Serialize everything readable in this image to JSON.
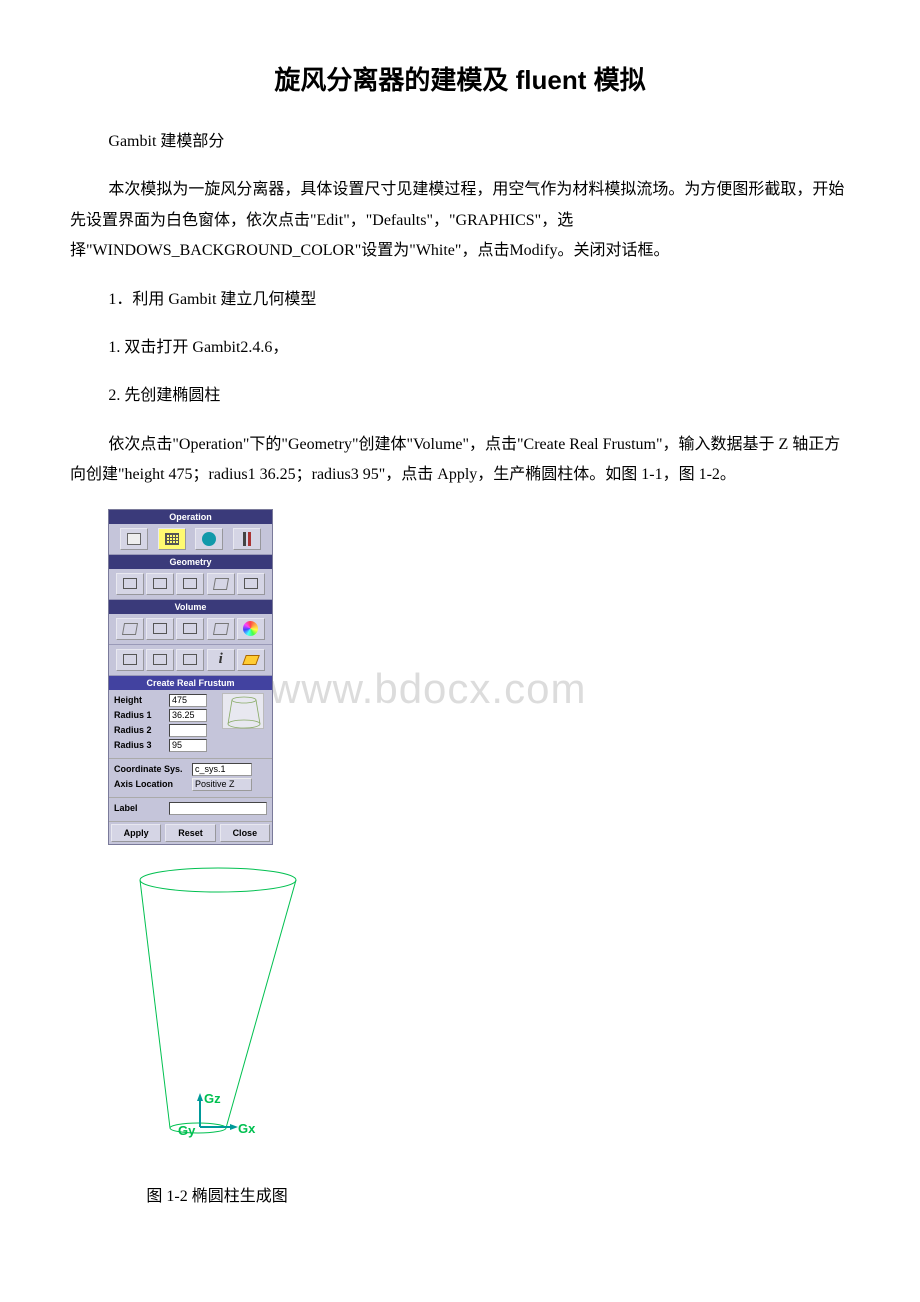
{
  "title": "旋风分离器的建模及 fluent 模拟",
  "paragraphs": {
    "p1": "Gambit 建模部分",
    "p2": "本次模拟为一旋风分离器，具体设置尺寸见建模过程，用空气作为材料模拟流场。为方便图形截取，开始先设置界面为白色窗体，依次点击\"Edit\"，\"Defaults\"，\"GRAPHICS\"，选择\"WINDOWS_BACKGROUND_COLOR\"设置为\"White\"，点击Modify。关闭对话框。",
    "p3": "1．利用 Gambit 建立几何模型",
    "p4": "1. 双击打开 Gambit2.4.6，",
    "p5": "2. 先创建椭圆柱",
    "p6": "依次点击\"Operation\"下的\"Geometry\"创建体\"Volume\"，点击\"Create Real Frustum\"，输入数据基于 Z 轴正方向创建\"height 475；radius1 36.25；radius3 95\"，点击 Apply，生产椭圆柱体。如图 1-1，图 1-2。"
  },
  "watermark": "www.bdocx.com",
  "panel": {
    "operation": "Operation",
    "geometry": "Geometry",
    "volume": "Volume",
    "create_frustum": "Create Real Frustum",
    "height_label": "Height",
    "height_value": "475",
    "radius1_label": "Radius 1",
    "radius1_value": "36.25",
    "radius2_label": "Radius 2",
    "radius2_value": "",
    "radius3_label": "Radius 3",
    "radius3_value": "95",
    "coord_sys_label": "Coordinate Sys.",
    "coord_sys_value": "c_sys.1",
    "axis_loc_label": "Axis Location",
    "axis_loc_value": "Positive Z",
    "label_label": "Label",
    "label_value": "",
    "btn_apply": "Apply",
    "btn_reset": "Reset",
    "btn_close": "Close",
    "info_symbol": "i"
  },
  "cone": {
    "gz": "Gz",
    "gy": "Gy",
    "gx": "Gx"
  },
  "caption": "图 1-2 椭圆柱生成图"
}
